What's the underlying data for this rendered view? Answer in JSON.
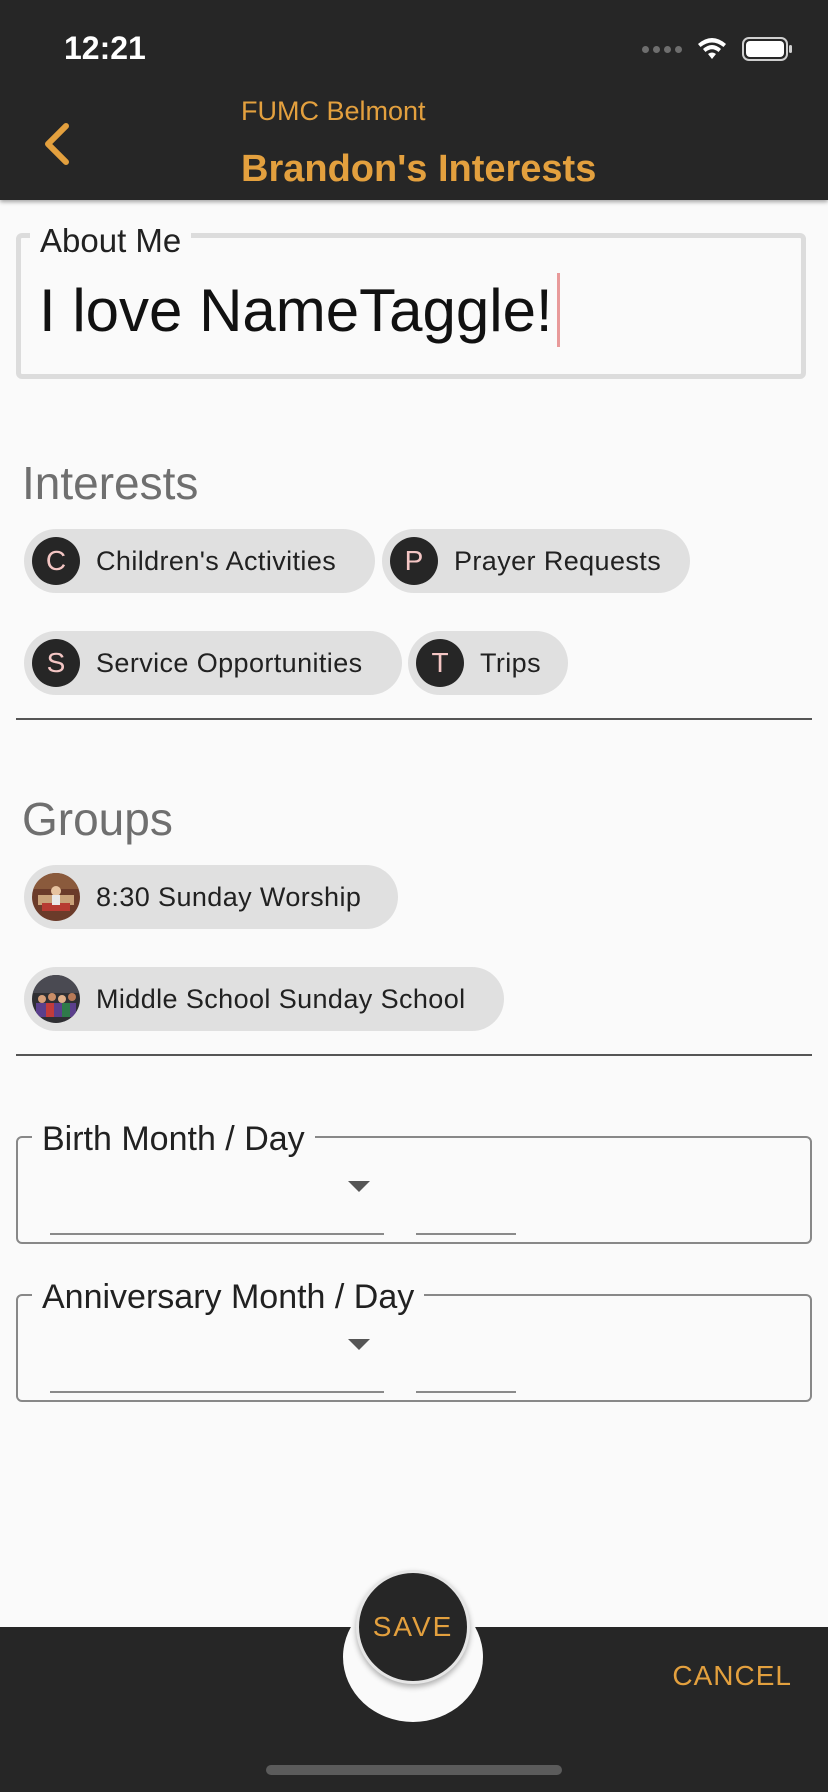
{
  "status_bar": {
    "time": "12:21"
  },
  "header": {
    "subtitle": "FUMC Belmont",
    "title": "Brandon's Interests",
    "back_icon": "chevron-left-icon"
  },
  "about": {
    "label": "About Me",
    "value": "I love NameTaggle!"
  },
  "interests": {
    "title": "Interests",
    "chips": [
      {
        "initial": "C",
        "label": "Children's Activities"
      },
      {
        "initial": "P",
        "label": "Prayer Requests"
      },
      {
        "initial": "S",
        "label": "Service Opportunities"
      },
      {
        "initial": "T",
        "label": "Trips"
      }
    ]
  },
  "groups": {
    "title": "Groups",
    "chips": [
      {
        "label": "8:30 Sunday Worship",
        "icon": "group-photo"
      },
      {
        "label": "Middle School Sunday School",
        "icon": "group-photo"
      }
    ]
  },
  "dates": {
    "birth_label": "Birth Month / Day",
    "anniversary_label": "Anniversary Month / Day"
  },
  "actions": {
    "save": "SAVE",
    "cancel": "CANCEL"
  },
  "colors": {
    "accent": "#e3a03e",
    "bar": "#262626",
    "chip": "#e0e0e0"
  }
}
